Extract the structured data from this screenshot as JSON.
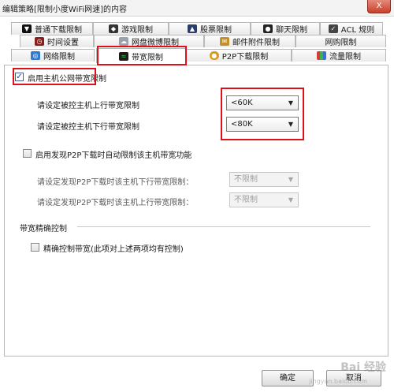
{
  "window": {
    "title": "编辑策略[限制小度WiFi网速]的内容",
    "close_label": "X"
  },
  "tabs": {
    "row1": [
      {
        "label": "普通下载限制",
        "icon": "download-icon"
      },
      {
        "label": "游戏限制",
        "icon": "game-icon"
      },
      {
        "label": "股票限制",
        "icon": "stock-icon"
      },
      {
        "label": "聊天限制",
        "icon": "chat-icon"
      },
      {
        "label": "ACL 规则",
        "icon": "acl-icon"
      }
    ],
    "row2": [
      {
        "label": "时间设置",
        "icon": "clock-icon"
      },
      {
        "label": "网盘微博限制",
        "icon": "cloud-icon"
      },
      {
        "label": "邮件附件限制",
        "icon": "mail-icon"
      },
      {
        "label": "网购限制",
        "icon": ""
      }
    ],
    "row3": [
      {
        "label": "网络限制",
        "icon": "network-icon"
      },
      {
        "label": "带宽限制",
        "icon": "bandwidth-icon"
      },
      {
        "label": "P2P下载限制",
        "icon": "p2p-icon"
      },
      {
        "label": "流量限制",
        "icon": "traffic-icon"
      }
    ]
  },
  "bandwidth": {
    "enable_label": "启用主机公网带宽限制",
    "upload_label": "请设定被控主机上行带宽限制",
    "upload_value": "<60K",
    "download_label": "请设定被控主机下行带宽限制",
    "download_value": "<80K",
    "p2p_enable_label": "启用发现P2P下载时自动限制该主机带宽功能",
    "p2p_download_label": "请设定发现P2P下载时该主机下行带宽限制：",
    "p2p_download_value": "不限制",
    "p2p_upload_label": "请设定发现P2P下载时该主机上行带宽限制：",
    "p2p_upload_value": "不限制",
    "precise_section": "带宽精确控制",
    "precise_label": "精确控制带宽(此项对上述两项均有控制)"
  },
  "buttons": {
    "ok": "确定",
    "cancel": "取消"
  },
  "watermark": {
    "main": "Bai 经验",
    "sub": "jingyan.baidu.com"
  },
  "colors": {
    "highlight": "#e0101a"
  }
}
